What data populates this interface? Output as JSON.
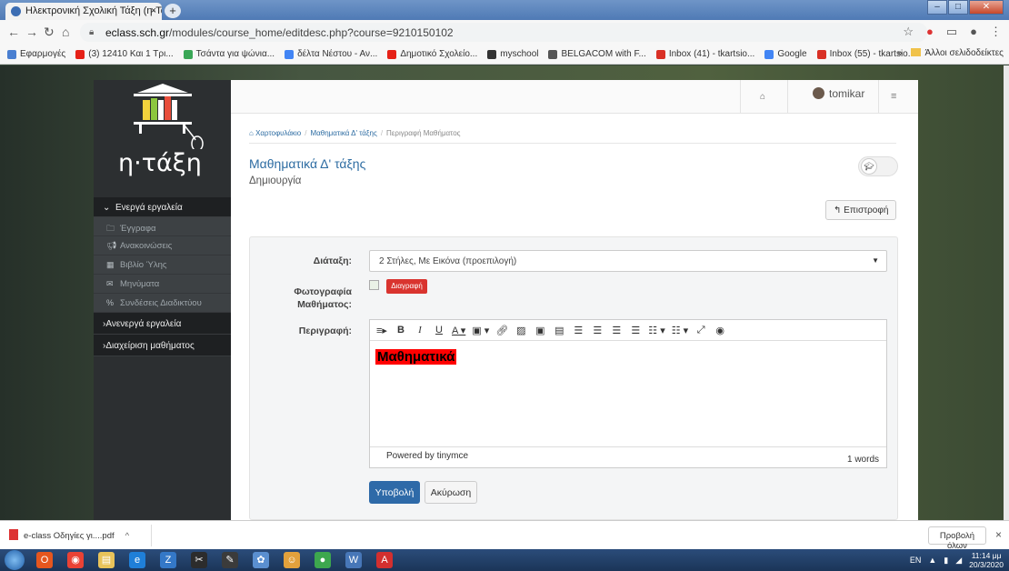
{
  "browser": {
    "tab_title": "Ηλεκτρονική Σχολική Τάξη (η-Τά",
    "tab_close": "×",
    "new_tab": "+",
    "url_host": "eclass.sch.gr",
    "url_path": "/modules/course_home/editdesc.php?course=9210150102",
    "bookmarks": [
      {
        "label": "Εφαρμογές",
        "icon": "apps-icon",
        "color": "#4a7fd1"
      },
      {
        "label": "(3) 12410 Και 1 Τρι...",
        "icon": "youtube-icon",
        "color": "#e62117"
      },
      {
        "label": "Τσάντα για ψώνια...",
        "icon": "globe-icon",
        "color": "#3aa757"
      },
      {
        "label": "δέλτα Νέστου - Αν...",
        "icon": "google-icon",
        "color": "#4285f4"
      },
      {
        "label": "Δημοτικό Σχολείο...",
        "icon": "youtube-icon",
        "color": "#e62117"
      },
      {
        "label": "myschool",
        "icon": "pi-icon",
        "color": "#333333"
      },
      {
        "label": "BELGACOM with F...",
        "icon": "globe-icon",
        "color": "#555555"
      },
      {
        "label": "Inbox (41) - tkartsio...",
        "icon": "gmail-icon",
        "color": "#d93025"
      },
      {
        "label": "Google",
        "icon": "google-icon",
        "color": "#4285f4"
      },
      {
        "label": "Inbox (55) - tkartsio...",
        "icon": "gmail-icon",
        "color": "#d93025"
      }
    ],
    "bookmarks_more": "»",
    "other_bookmarks": "Άλλοι σελιδοδείκτες"
  },
  "sidebar": {
    "logo_text": "η·τάξη",
    "sections": [
      {
        "label": "Ενεργά εργαλεία",
        "expanded": true
      },
      {
        "label": "Ανενεργά εργαλεία",
        "expanded": false
      },
      {
        "label": "Διαχείριση μαθήματος",
        "expanded": false
      }
    ],
    "items": [
      {
        "label": "Έγγραφα",
        "icon": "folder-icon"
      },
      {
        "label": "Ανακοινώσεις",
        "icon": "megaphone-icon"
      },
      {
        "label": "Βιβλίο Ύλης",
        "icon": "calendar-icon"
      },
      {
        "label": "Μηνύματα",
        "icon": "envelope-icon"
      },
      {
        "label": "Συνδέσεις Διαδικτύου",
        "icon": "link-icon"
      }
    ]
  },
  "header": {
    "username": "tomikar"
  },
  "breadcrumb": [
    {
      "label": "Χαρτοφυλάκιο",
      "link": true
    },
    {
      "label": "Μαθηματικά Δ' τάξης",
      "link": true
    },
    {
      "label": "Περιγραφή Μαθήματος",
      "link": false
    }
  ],
  "course": {
    "title": "Μαθηματικά Δ' τάξης",
    "subtitle": "Δημιουργία"
  },
  "back_button": "Επιστροφή",
  "form": {
    "layout_label": "Διάταξη:",
    "layout_value": "2 Στήλες, Με Εικόνα (προεπιλογή)",
    "photo_label_1": "Φωτογραφία",
    "photo_label_2": "Μαθήματος:",
    "delete_button": "Διαγραφή",
    "description_label": "Περιγραφή:",
    "editor_content": "Μαθηματικά",
    "highlight_color": "#ff0000",
    "powered_by": "Powered by tinymce",
    "word_count": "1 words",
    "submit": "Υποβολή",
    "cancel": "Ακύρωση"
  },
  "downloads": {
    "file": "e-class Οδηγίες γι....pdf",
    "show_all": "Προβολή όλων",
    "close": "×"
  },
  "taskbar": {
    "lang": "EN",
    "time": "11:14 μμ",
    "date": "20/3/2020"
  }
}
